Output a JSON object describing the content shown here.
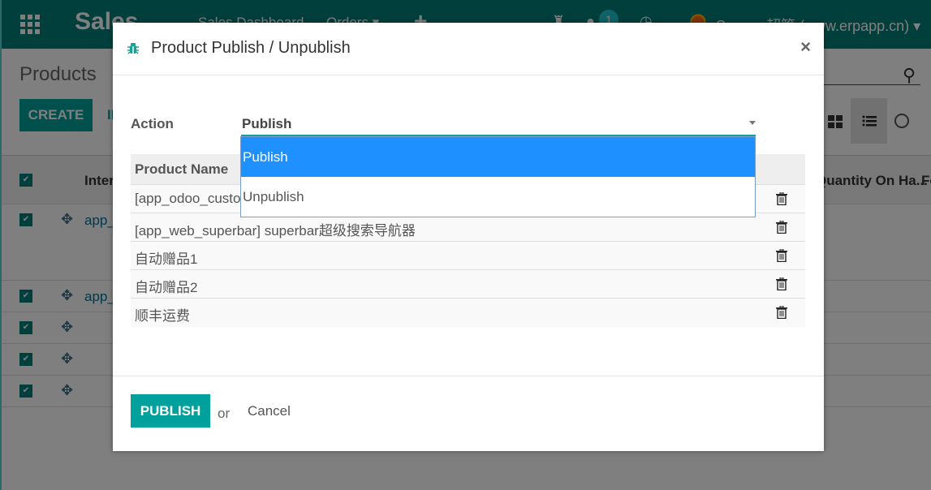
{
  "navbar": {
    "app_name": "Sales",
    "menu": [
      "Sales Dashboard",
      "Orders ▾"
    ],
    "add_icon": "plus-icon",
    "message_count": "1",
    "user": "Sunpop超管 (www.erpapp.cn) ▾"
  },
  "control_panel": {
    "breadcrumb": "Products",
    "create_label": "CREATE",
    "import_label": "IMPORT"
  },
  "list": {
    "headers": [
      "Internal Reference",
      "Quantity On Ha...",
      "Fo"
    ],
    "rows": [
      "app_odoo_customize",
      "app_web_superbar",
      "",
      "",
      ""
    ]
  },
  "modal": {
    "title": "Product Publish / Unpublish",
    "close_label": "×",
    "action_label": "Action",
    "action_value": "Publish",
    "action_options": [
      {
        "label": "Publish",
        "selected": true
      },
      {
        "label": "Unpublish",
        "selected": false
      }
    ],
    "table_header": "Product Name",
    "products": [
      "[app_odoo_customize] Odoo customize",
      "[app_web_superbar] superbar超级搜索导航器",
      "自动赠品1",
      "自动赠品2",
      "顺丰运费"
    ],
    "publish_label": "PUBLISH",
    "or_label": "or",
    "cancel_label": "Cancel"
  },
  "colors": {
    "brand": "#017e78",
    "primary_button": "#00a09d",
    "dropdown_highlight": "#1e90ff"
  }
}
